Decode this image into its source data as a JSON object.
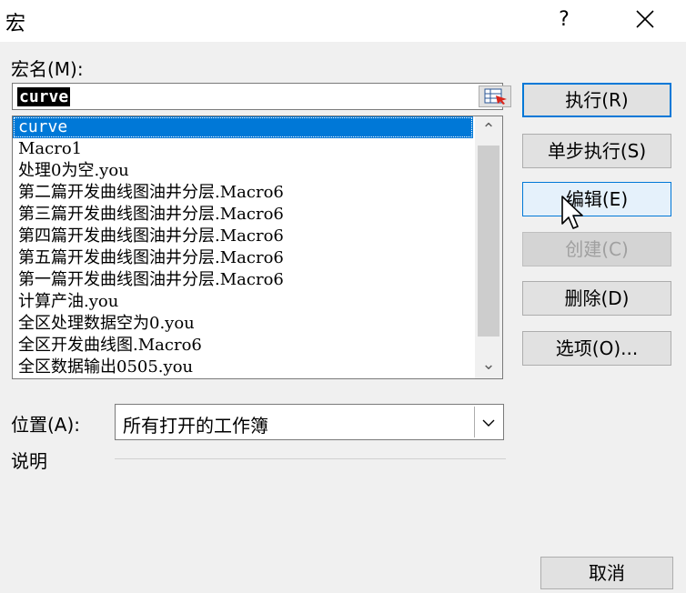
{
  "window": {
    "title": "宏",
    "help": "?"
  },
  "macro_name": {
    "label": "宏名(M):",
    "value": "curve"
  },
  "macros": [
    "curve",
    "Macro1",
    "处理0为空.you",
    "第二篇开发曲线图油井分层.Macro6",
    "第三篇开发曲线图油井分层.Macro6",
    "第四篇开发曲线图油井分层.Macro6",
    "第五篇开发曲线图油井分层.Macro6",
    "第一篇开发曲线图油井分层.Macro6",
    "计算产油.you",
    "全区处理数据空为0.you",
    "全区开发曲线图.Macro6",
    "全区数据输出0505.you"
  ],
  "location": {
    "label": "位置(A):",
    "value": "所有打开的工作簿"
  },
  "description": {
    "label": "说明"
  },
  "buttons": {
    "run": "执行(R)",
    "step": "单步执行(S)",
    "edit": "编辑(E)",
    "create": "创建(C)",
    "delete": "删除(D)",
    "options": "选项(O)...",
    "cancel": "取消"
  },
  "colors": {
    "selection": "#0078d7",
    "focus": "#0078d7"
  }
}
